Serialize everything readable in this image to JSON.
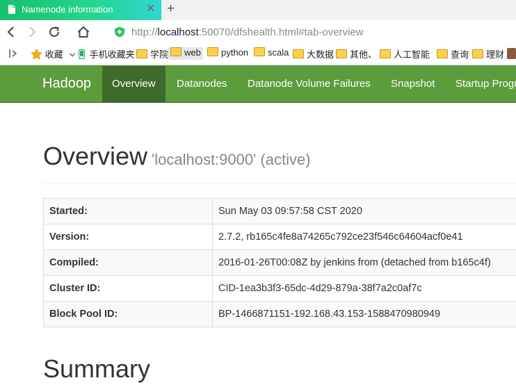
{
  "browser": {
    "tab_title": "Namenode information",
    "url_prefix": "http://",
    "url_host": "localhost",
    "url_rest": ":50070/dfshealth.html#tab-overview"
  },
  "bookmarks": [
    "收藏",
    "手机收藏夹",
    "学院",
    "web",
    "python",
    "scala",
    "大数据",
    "其他、",
    "人工智能",
    "查询",
    "理财"
  ],
  "hadoop_nav": {
    "brand": "Hadoop",
    "items": [
      "Overview",
      "Datanodes",
      "Datanode Volume Failures",
      "Snapshot",
      "Startup Progress"
    ]
  },
  "overview": {
    "title": "Overview",
    "subtitle": "'localhost:9000' (active)",
    "rows": [
      {
        "key": "Started:",
        "value": "Sun May 03 09:57:58 CST 2020"
      },
      {
        "key": "Version:",
        "value": "2.7.2, rb165c4fe8a74265c792ce23f546c64604acf0e41"
      },
      {
        "key": "Compiled:",
        "value": "2016-01-26T00:08Z by jenkins from (detached from b165c4f)"
      },
      {
        "key": "Cluster ID:",
        "value": "CID-1ea3b3f3-65dc-4d29-879a-38f7a2c0af7c"
      },
      {
        "key": "Block Pool ID:",
        "value": "BP-1466871151-192.168.43.153-1588470980949"
      }
    ]
  },
  "summary": {
    "title": "Summary"
  },
  "colors": {
    "hadoop_green": "#5b9c3d",
    "active_green": "#3e6b2a",
    "tab_green": "#24d58b"
  }
}
